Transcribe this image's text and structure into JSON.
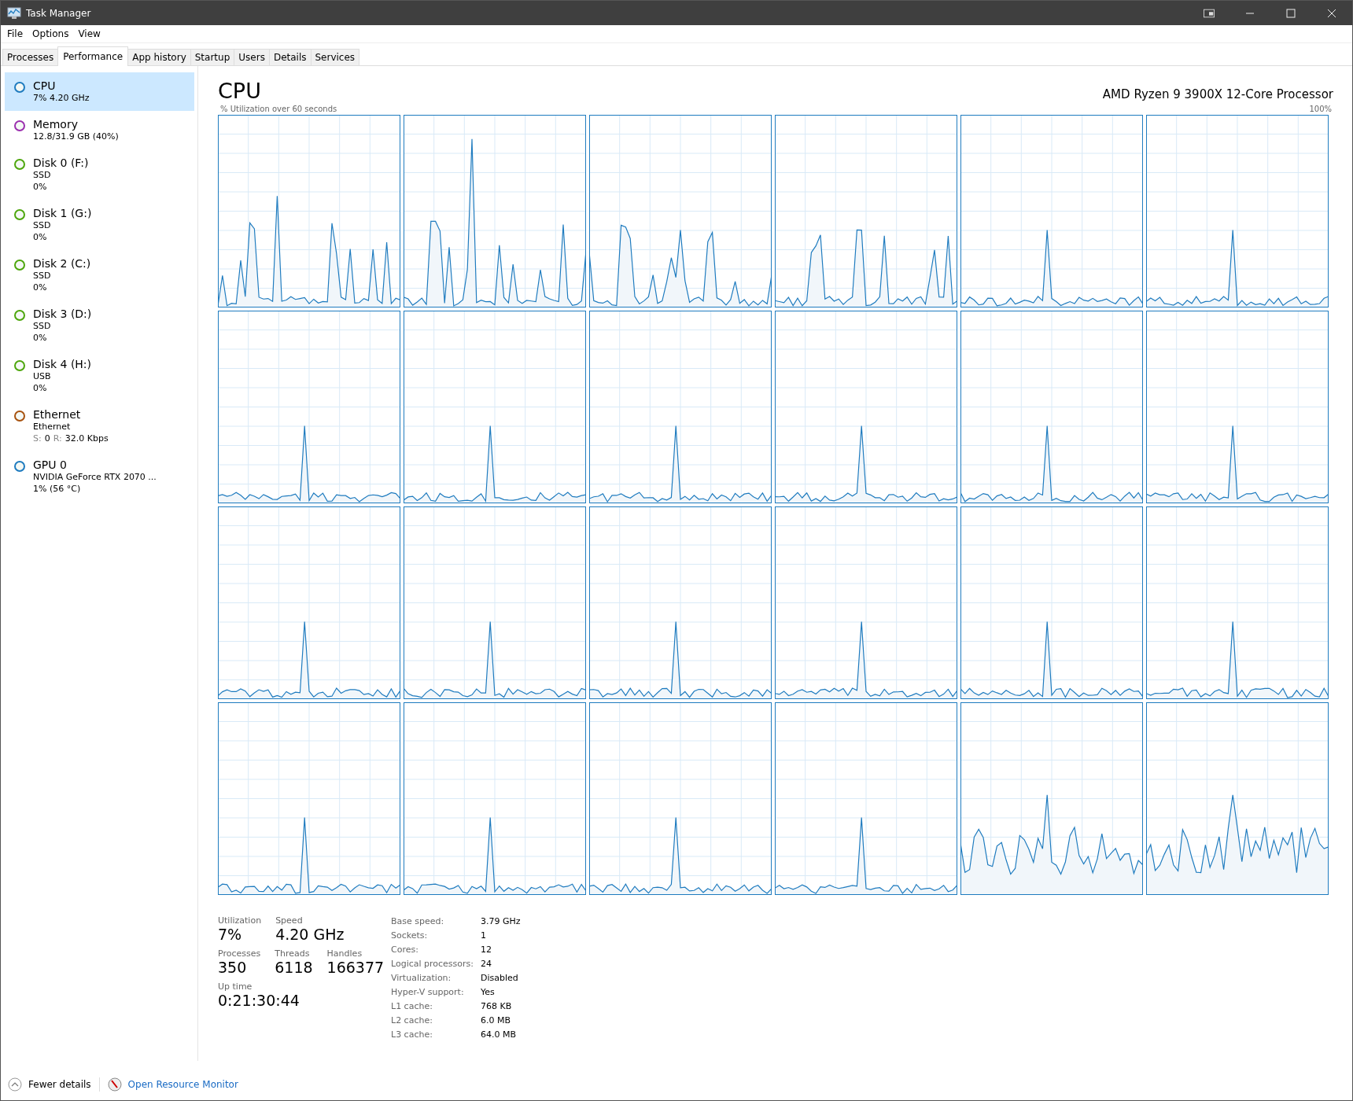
{
  "window": {
    "title": "Task Manager"
  },
  "menu": [
    "File",
    "Options",
    "View"
  ],
  "tabs": [
    {
      "label": "Processes",
      "selected": false
    },
    {
      "label": "Performance",
      "selected": true
    },
    {
      "label": "App history",
      "selected": false
    },
    {
      "label": "Startup",
      "selected": false
    },
    {
      "label": "Users",
      "selected": false
    },
    {
      "label": "Details",
      "selected": false
    },
    {
      "label": "Services",
      "selected": false
    }
  ],
  "sidebar": {
    "items": [
      {
        "name": "CPU",
        "lines": [
          "7%  4.20 GHz"
        ],
        "color": "#1e7bbf",
        "selected": true
      },
      {
        "name": "Memory",
        "lines": [
          "12.8/31.9 GB (40%)"
        ],
        "color": "#9b2fae",
        "selected": false
      },
      {
        "name": "Disk 0 (F:)",
        "lines": [
          "SSD",
          "0%"
        ],
        "color": "#4da60c",
        "selected": false
      },
      {
        "name": "Disk 1 (G:)",
        "lines": [
          "SSD",
          "0%"
        ],
        "color": "#4da60c",
        "selected": false
      },
      {
        "name": "Disk 2 (C:)",
        "lines": [
          "SSD",
          "0%"
        ],
        "color": "#4da60c",
        "selected": false
      },
      {
        "name": "Disk 3 (D:)",
        "lines": [
          "SSD",
          "0%"
        ],
        "color": "#4da60c",
        "selected": false
      },
      {
        "name": "Disk 4 (H:)",
        "lines": [
          "USB",
          "0%"
        ],
        "color": "#4da60c",
        "selected": false
      },
      {
        "name": "Ethernet",
        "lines": [
          "Ethernet"
        ],
        "throughput": [
          {
            "label": "S:",
            "value": "0"
          },
          {
            "label": "R:",
            "value": "32.0 Kbps"
          }
        ],
        "color": "#a7520f",
        "selected": false
      },
      {
        "name": "GPU 0",
        "lines": [
          "NVIDIA GeForce RTX 2070 ...",
          "1%  (56 °C)"
        ],
        "color": "#1e7bbf",
        "selected": false
      }
    ]
  },
  "header": {
    "title": "CPU",
    "processor": "AMD Ryzen 9 3900X 12-Core Processor",
    "graph_caption": "% Utilization over 60 seconds",
    "graph_max": "100%"
  },
  "stats": {
    "groups": [
      [
        {
          "label": "Utilization",
          "value": "7%"
        },
        {
          "label": "Speed",
          "value": "4.20 GHz"
        }
      ],
      [
        {
          "label": "Processes",
          "value": "350"
        },
        {
          "label": "Threads",
          "value": "6118"
        },
        {
          "label": "Handles",
          "value": "166377"
        }
      ],
      [
        {
          "label": "Up time",
          "value": "0:21:30:44"
        }
      ]
    ],
    "details": [
      {
        "key": "Base speed:",
        "value": "3.79 GHz"
      },
      {
        "key": "Sockets:",
        "value": "1"
      },
      {
        "key": "Cores:",
        "value": "12"
      },
      {
        "key": "Logical processors:",
        "value": "24"
      },
      {
        "key": "Virtualization:",
        "value": "Disabled"
      },
      {
        "key": "Hyper-V support:",
        "value": "Yes"
      },
      {
        "key": "L1 cache:",
        "value": "768 KB"
      },
      {
        "key": "L2 cache:",
        "value": "6.0 MB"
      },
      {
        "key": "L3 cache:",
        "value": "64.0 MB"
      }
    ]
  },
  "footer": {
    "fewer_details": "Fewer details",
    "resource_monitor": "Open Resource Monitor"
  }
}
